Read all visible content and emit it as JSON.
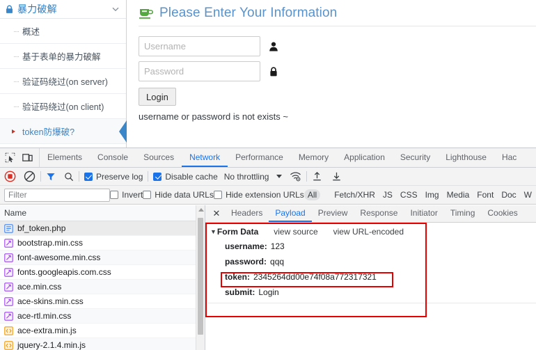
{
  "sidebar": {
    "header": {
      "title": "暴力破解",
      "lock_icon": "lock-icon",
      "chevron": "chevron-down-icon"
    },
    "items": [
      {
        "label": "概述",
        "active": false
      },
      {
        "label": "基于表单的暴力破解",
        "active": false
      },
      {
        "label": "验证码绕过(on server)",
        "active": false
      },
      {
        "label": "验证码绕过(on client)",
        "active": false
      },
      {
        "label": "token防爆破?",
        "active": true
      }
    ]
  },
  "main": {
    "title": "Please Enter Your Information",
    "cup_icon": "coffee-cup-icon",
    "username": {
      "placeholder": "Username",
      "value": "",
      "icon": "user-icon"
    },
    "password": {
      "placeholder": "Password",
      "value": "",
      "icon": "lock-icon"
    },
    "login_label": "Login",
    "error_message": "username or password is not exists ~"
  },
  "devtools": {
    "tool_icons": [
      "inspect-element-icon",
      "device-toolbar-icon"
    ],
    "tabs": [
      {
        "label": "Elements",
        "active": false
      },
      {
        "label": "Console",
        "active": false
      },
      {
        "label": "Sources",
        "active": false
      },
      {
        "label": "Network",
        "active": true
      },
      {
        "label": "Performance",
        "active": false
      },
      {
        "label": "Memory",
        "active": false
      },
      {
        "label": "Application",
        "active": false
      },
      {
        "label": "Security",
        "active": false
      },
      {
        "label": "Lighthouse",
        "active": false
      },
      {
        "label": "Hac",
        "active": false
      }
    ],
    "controls": {
      "record_icon": "record-stop-icon",
      "clear_icon": "clear-icon",
      "filter_icon": "filter-funnel-icon",
      "search_icon": "search-icon",
      "preserve_log": {
        "label": "Preserve log",
        "checked": true
      },
      "disable_cache": {
        "label": "Disable cache",
        "checked": true
      },
      "throttling": "No throttling",
      "throttle_caret": "chevron-down-icon",
      "wifi_icon": "network-conditions-icon",
      "import_icon": "import-har-icon",
      "export_icon": "export-har-icon"
    },
    "filterbar": {
      "filter_placeholder": "Filter",
      "filter_value": "",
      "invert": {
        "label": "Invert",
        "checked": false
      },
      "hide_data_urls": {
        "label": "Hide data URLs",
        "checked": false
      },
      "hide_extension_urls": {
        "label": "Hide extension URLs",
        "checked": false
      },
      "types": [
        "All",
        "Fetch/XHR",
        "JS",
        "CSS",
        "Img",
        "Media",
        "Font",
        "Doc",
        "W"
      ],
      "selected_type": "All"
    },
    "requests": {
      "column_header": "Name",
      "rows": [
        {
          "name": "bf_token.php",
          "icon": "document-icon",
          "selected": true
        },
        {
          "name": "bootstrap.min.css",
          "icon": "stylesheet-icon",
          "selected": false
        },
        {
          "name": "font-awesome.min.css",
          "icon": "stylesheet-icon",
          "selected": false
        },
        {
          "name": "fonts.googleapis.com.css",
          "icon": "stylesheet-icon",
          "selected": false
        },
        {
          "name": "ace.min.css",
          "icon": "stylesheet-icon",
          "selected": false
        },
        {
          "name": "ace-skins.min.css",
          "icon": "stylesheet-icon",
          "selected": false
        },
        {
          "name": "ace-rtl.min.css",
          "icon": "stylesheet-icon",
          "selected": false
        },
        {
          "name": "ace-extra.min.js",
          "icon": "script-icon",
          "selected": false
        },
        {
          "name": "jquery-2.1.4.min.js",
          "icon": "script-icon",
          "selected": false
        }
      ]
    },
    "detail": {
      "close_icon": "close-icon",
      "tabs": [
        {
          "label": "Headers",
          "active": false
        },
        {
          "label": "Payload",
          "active": true
        },
        {
          "label": "Preview",
          "active": false
        },
        {
          "label": "Response",
          "active": false
        },
        {
          "label": "Initiator",
          "active": false
        },
        {
          "label": "Timing",
          "active": false
        },
        {
          "label": "Cookies",
          "active": false
        }
      ],
      "payload": {
        "section_title": "Form Data",
        "caret": "caret-down-icon",
        "view_source": "view source",
        "view_url_encoded": "view URL-encoded",
        "fields": [
          {
            "key": "username:",
            "value": "123",
            "highlighted": false
          },
          {
            "key": "password:",
            "value": "qqq",
            "highlighted": false
          },
          {
            "key": "token:",
            "value": "2345264dd00e74f08a772317321",
            "highlighted": true
          },
          {
            "key": "submit:",
            "value": "Login",
            "highlighted": false
          }
        ]
      }
    }
  },
  "annotations": {
    "color": "#e60000",
    "outer_box": "form-data-highlight",
    "inner_box": "token-highlight"
  }
}
